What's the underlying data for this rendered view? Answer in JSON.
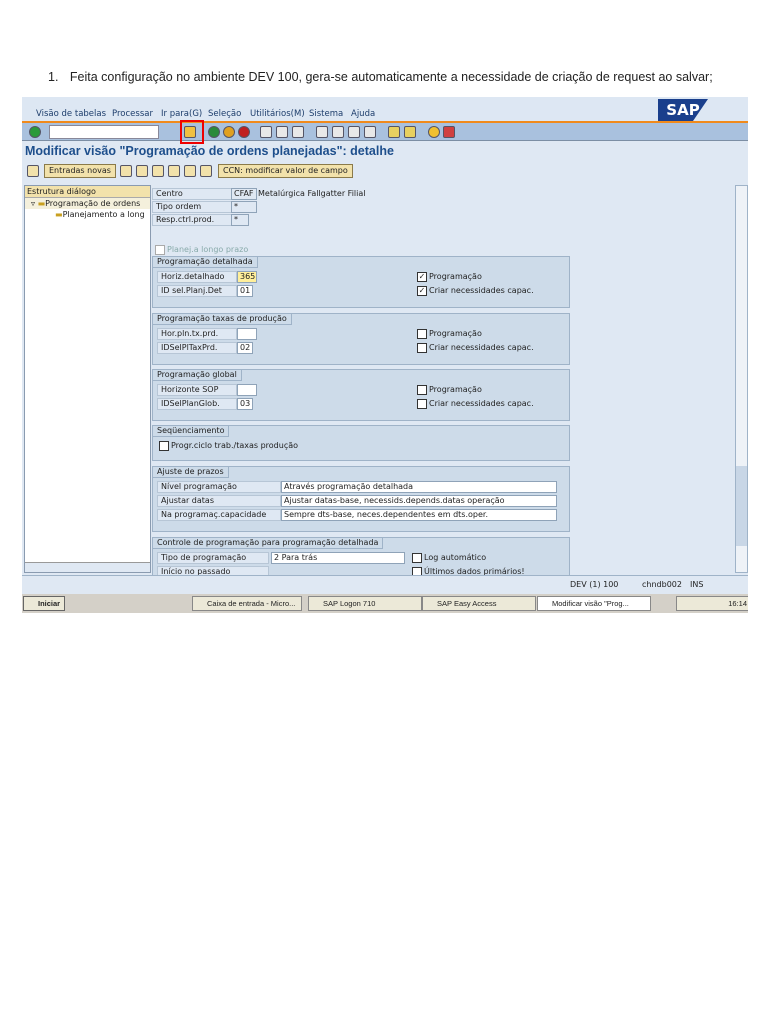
{
  "doc": {
    "num": "1.",
    "text": "Feita configuração no ambiente DEV 100, gera-se automaticamente a necessidade de criação de request ao salvar;"
  },
  "menu": [
    "Visão de tabelas",
    "Processar",
    "Ir para(G)",
    "Seleção",
    "Utilitários(M)",
    "Sistema",
    "Ajuda"
  ],
  "logo": "SAP",
  "title": "Modificar visão \"Programação de ordens planejadas\": detalhe",
  "apptb": {
    "new": "Entradas novas",
    "ccn": "CCN: modificar valor de campo"
  },
  "tree": {
    "header": "Estrutura diálogo",
    "items": [
      "Programação de ordens",
      "Planejamento a long"
    ]
  },
  "head": {
    "centro_l": "Centro",
    "centro_v": "CFAF",
    "centro_d": "Metalúrgica Fallgatter Filial",
    "tipo_l": "Tipo ordem",
    "tipo_v": "*",
    "resp_l": "Resp.ctrl.prod.",
    "resp_v": "*",
    "planej": "Planej.a longo prazo"
  },
  "g1": {
    "title": "Programação detalhada",
    "l1": "Horiz.detalhado",
    "v1": "365",
    "l2": "ID sel.Planj.Det",
    "v2": "01",
    "c1": "Programação",
    "c2": "Criar necessidades capac."
  },
  "g2": {
    "title": "Programação taxas de produção",
    "l1": "Hor.pln.tx.prd.",
    "v1": "",
    "l2": "IDSelPlTaxPrd.",
    "v2": "02",
    "c1": "Programação",
    "c2": "Criar necessidades capac."
  },
  "g3": {
    "title": "Programação global",
    "l1": "Horizonte SOP",
    "v1": "",
    "l2": "IDSelPlanGlob.",
    "v2": "03",
    "c1": "Programação",
    "c2": "Criar necessidades capac."
  },
  "g4": {
    "title": "Seqüenciamento",
    "c1": "Progr.ciclo trab./taxas produção"
  },
  "g5": {
    "title": "Ajuste de prazos",
    "l1": "Nível programação",
    "v1": "Através programação detalhada",
    "l2": "Ajustar datas",
    "v2": "Ajustar datas-base, necessids.depends.datas operação",
    "l3": "Na programaç.capacidade",
    "v3": "Sempre dts-base, neces.dependentes em dts.oper."
  },
  "g6": {
    "title": "Controle de programação para programação detalhada",
    "l1": "Tipo de programação",
    "v1": "2 Para trás",
    "c1": "Log automático",
    "l2": "Início no passado",
    "c2": "Últimos dados primários!"
  },
  "status": {
    "sys": "DEV (1) 100",
    "server": "chndb002",
    "mode": "INS"
  },
  "taskbar": {
    "start": "Iniciar",
    "items": [
      "Caixa de entrada - Micro...",
      "SAP Logon 710",
      "SAP Easy Access",
      "Modificar visão \"Prog..."
    ],
    "clock": "16:14"
  }
}
